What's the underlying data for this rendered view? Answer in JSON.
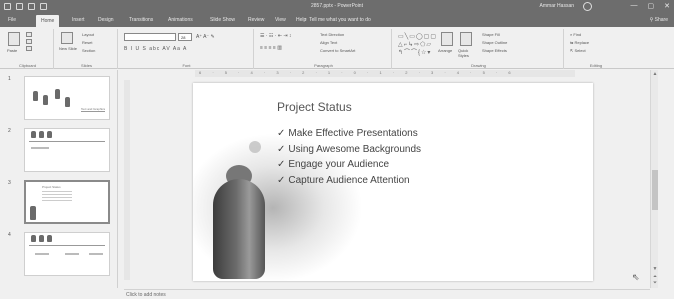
{
  "window": {
    "title": "2857.pptx - PowerPoint",
    "user": "Ammar Hassan",
    "controls": [
      "—",
      "▢",
      "✕"
    ]
  },
  "tabs": [
    "File",
    "Home",
    "Insert",
    "Design",
    "Transitions",
    "Animations",
    "Slide Show",
    "Review",
    "View",
    "Help"
  ],
  "tell_me": "Tell me what you want to do",
  "share": "Share",
  "ribbon": {
    "clipboard": {
      "label": "Clipboard",
      "paste": "Paste"
    },
    "slides": {
      "label": "Slides",
      "new_slide": "New Slide",
      "layout": "Layout",
      "reset": "Reset",
      "section": "Section"
    },
    "font": {
      "label": "Font",
      "size": "28",
      "format_row": "B I U S abc AV Aa A"
    },
    "paragraph": {
      "label": "Paragraph",
      "text_direction": "Text Direction",
      "align_text": "Align Text",
      "smartart": "Convert to SmartArt"
    },
    "drawing": {
      "label": "Drawing",
      "arrange": "Arrange",
      "quick_styles": "Quick Styles",
      "shape_fill": "Shape Fill",
      "shape_outline": "Shape Outline",
      "shape_effects": "Shape Effects"
    },
    "editing": {
      "label": "Editing",
      "find": "Find",
      "replace": "Replace",
      "select": "Select"
    }
  },
  "ruler_text": "6 · 5 · 4 · 3 · 2 · 1 · 0 · 1 · 2 · 3 · 4 · 5 · 6",
  "thumbnails": [
    {
      "number": "1",
      "title": "Text and Graphics"
    },
    {
      "number": "2",
      "title": ""
    },
    {
      "number": "3",
      "title": "Project Status"
    },
    {
      "number": "4",
      "title": ""
    }
  ],
  "slide": {
    "title": "Project Status",
    "bullets": [
      "Make Effective Presentations",
      "Using Awesome Backgrounds",
      "Engage your Audience",
      "Capture Audience Attention"
    ]
  },
  "notes_placeholder": "Click to add notes"
}
